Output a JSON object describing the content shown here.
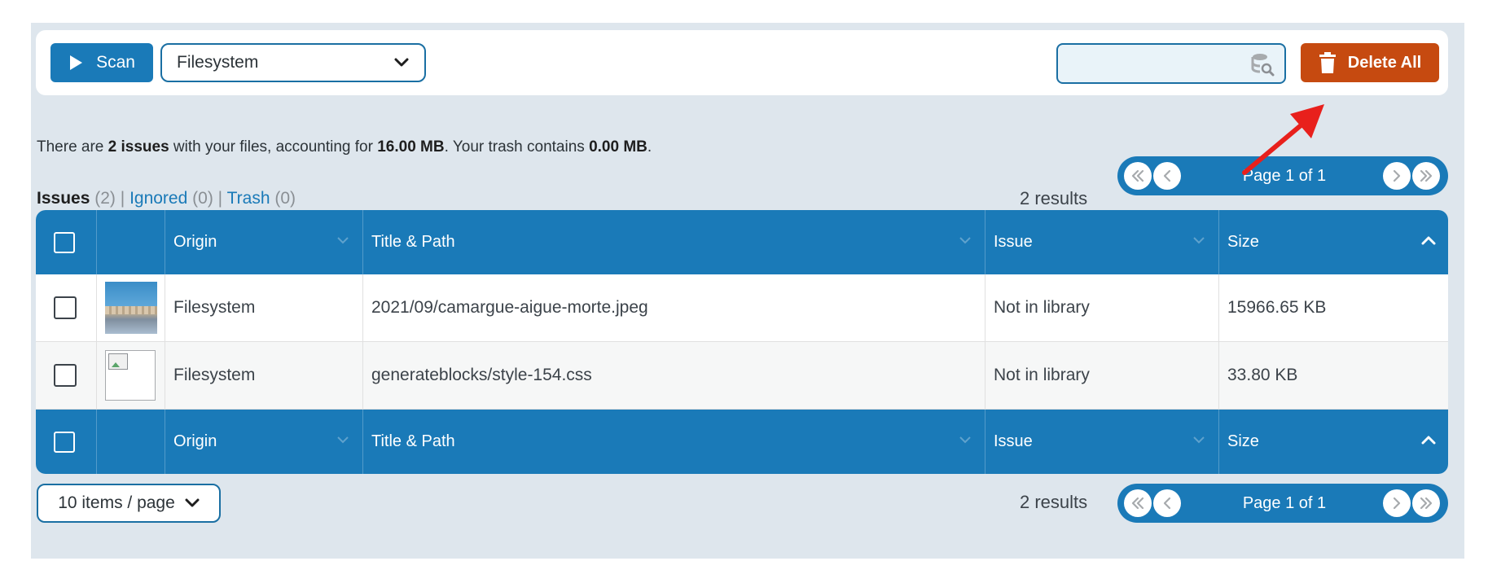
{
  "toolbar": {
    "scan_label": "Scan",
    "origin_value": "Filesystem",
    "search_placeholder": "",
    "delete_all_label": "Delete All"
  },
  "summary": {
    "prefix": "There are ",
    "issues": "2 issues",
    "mid1": " with your files, accounting for ",
    "size": "16.00 MB",
    "mid2": ". Your trash contains ",
    "trash": "0.00 MB",
    "suffix": "."
  },
  "filters": {
    "issues_label": "Issues",
    "issues_count": "(2)",
    "ignored_label": "Ignored",
    "ignored_count": "(0)",
    "trash_label": "Trash",
    "trash_count": "(0)",
    "separator": "|"
  },
  "results_text": "2 results",
  "pager_label": "Page 1 of 1",
  "columns": {
    "origin": "Origin",
    "title_path": "Title & Path",
    "issue": "Issue",
    "size": "Size"
  },
  "rows": [
    {
      "origin": "Filesystem",
      "path": "2021/09/camargue-aigue-morte.jpeg",
      "issue": "Not in library",
      "size": "15966.65 KB"
    },
    {
      "origin": "Filesystem",
      "path": "generateblocks/style-154.css",
      "issue": "Not in library",
      "size": "33.80 KB"
    }
  ],
  "per_page_label": "10 items / page",
  "colors": {
    "primary": "#1a7ab8",
    "delete": "#c64a10",
    "panel_bg": "#dee6ed",
    "annotation_arrow": "#e8201c"
  }
}
